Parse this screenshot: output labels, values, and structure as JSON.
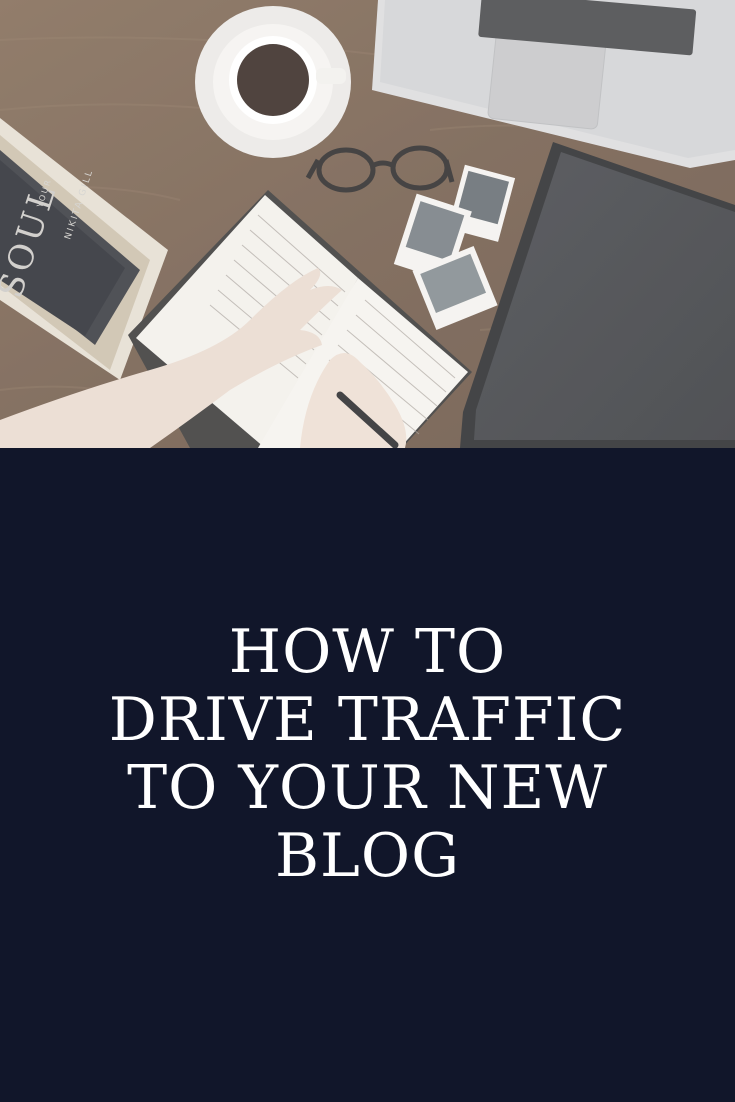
{
  "photo": {
    "book_cover_text": "SOUL",
    "book_spine_text": "NIKITA GILL",
    "book_cover_small": "YOUR"
  },
  "headline": {
    "lines": [
      "HOW TO",
      "DRIVE TRAFFIC",
      "TO YOUR NEW",
      "BLOG"
    ]
  },
  "colors": {
    "panel_background": "#11162a",
    "headline_text": "#ffffff",
    "desk_wood": "#6b5441"
  }
}
